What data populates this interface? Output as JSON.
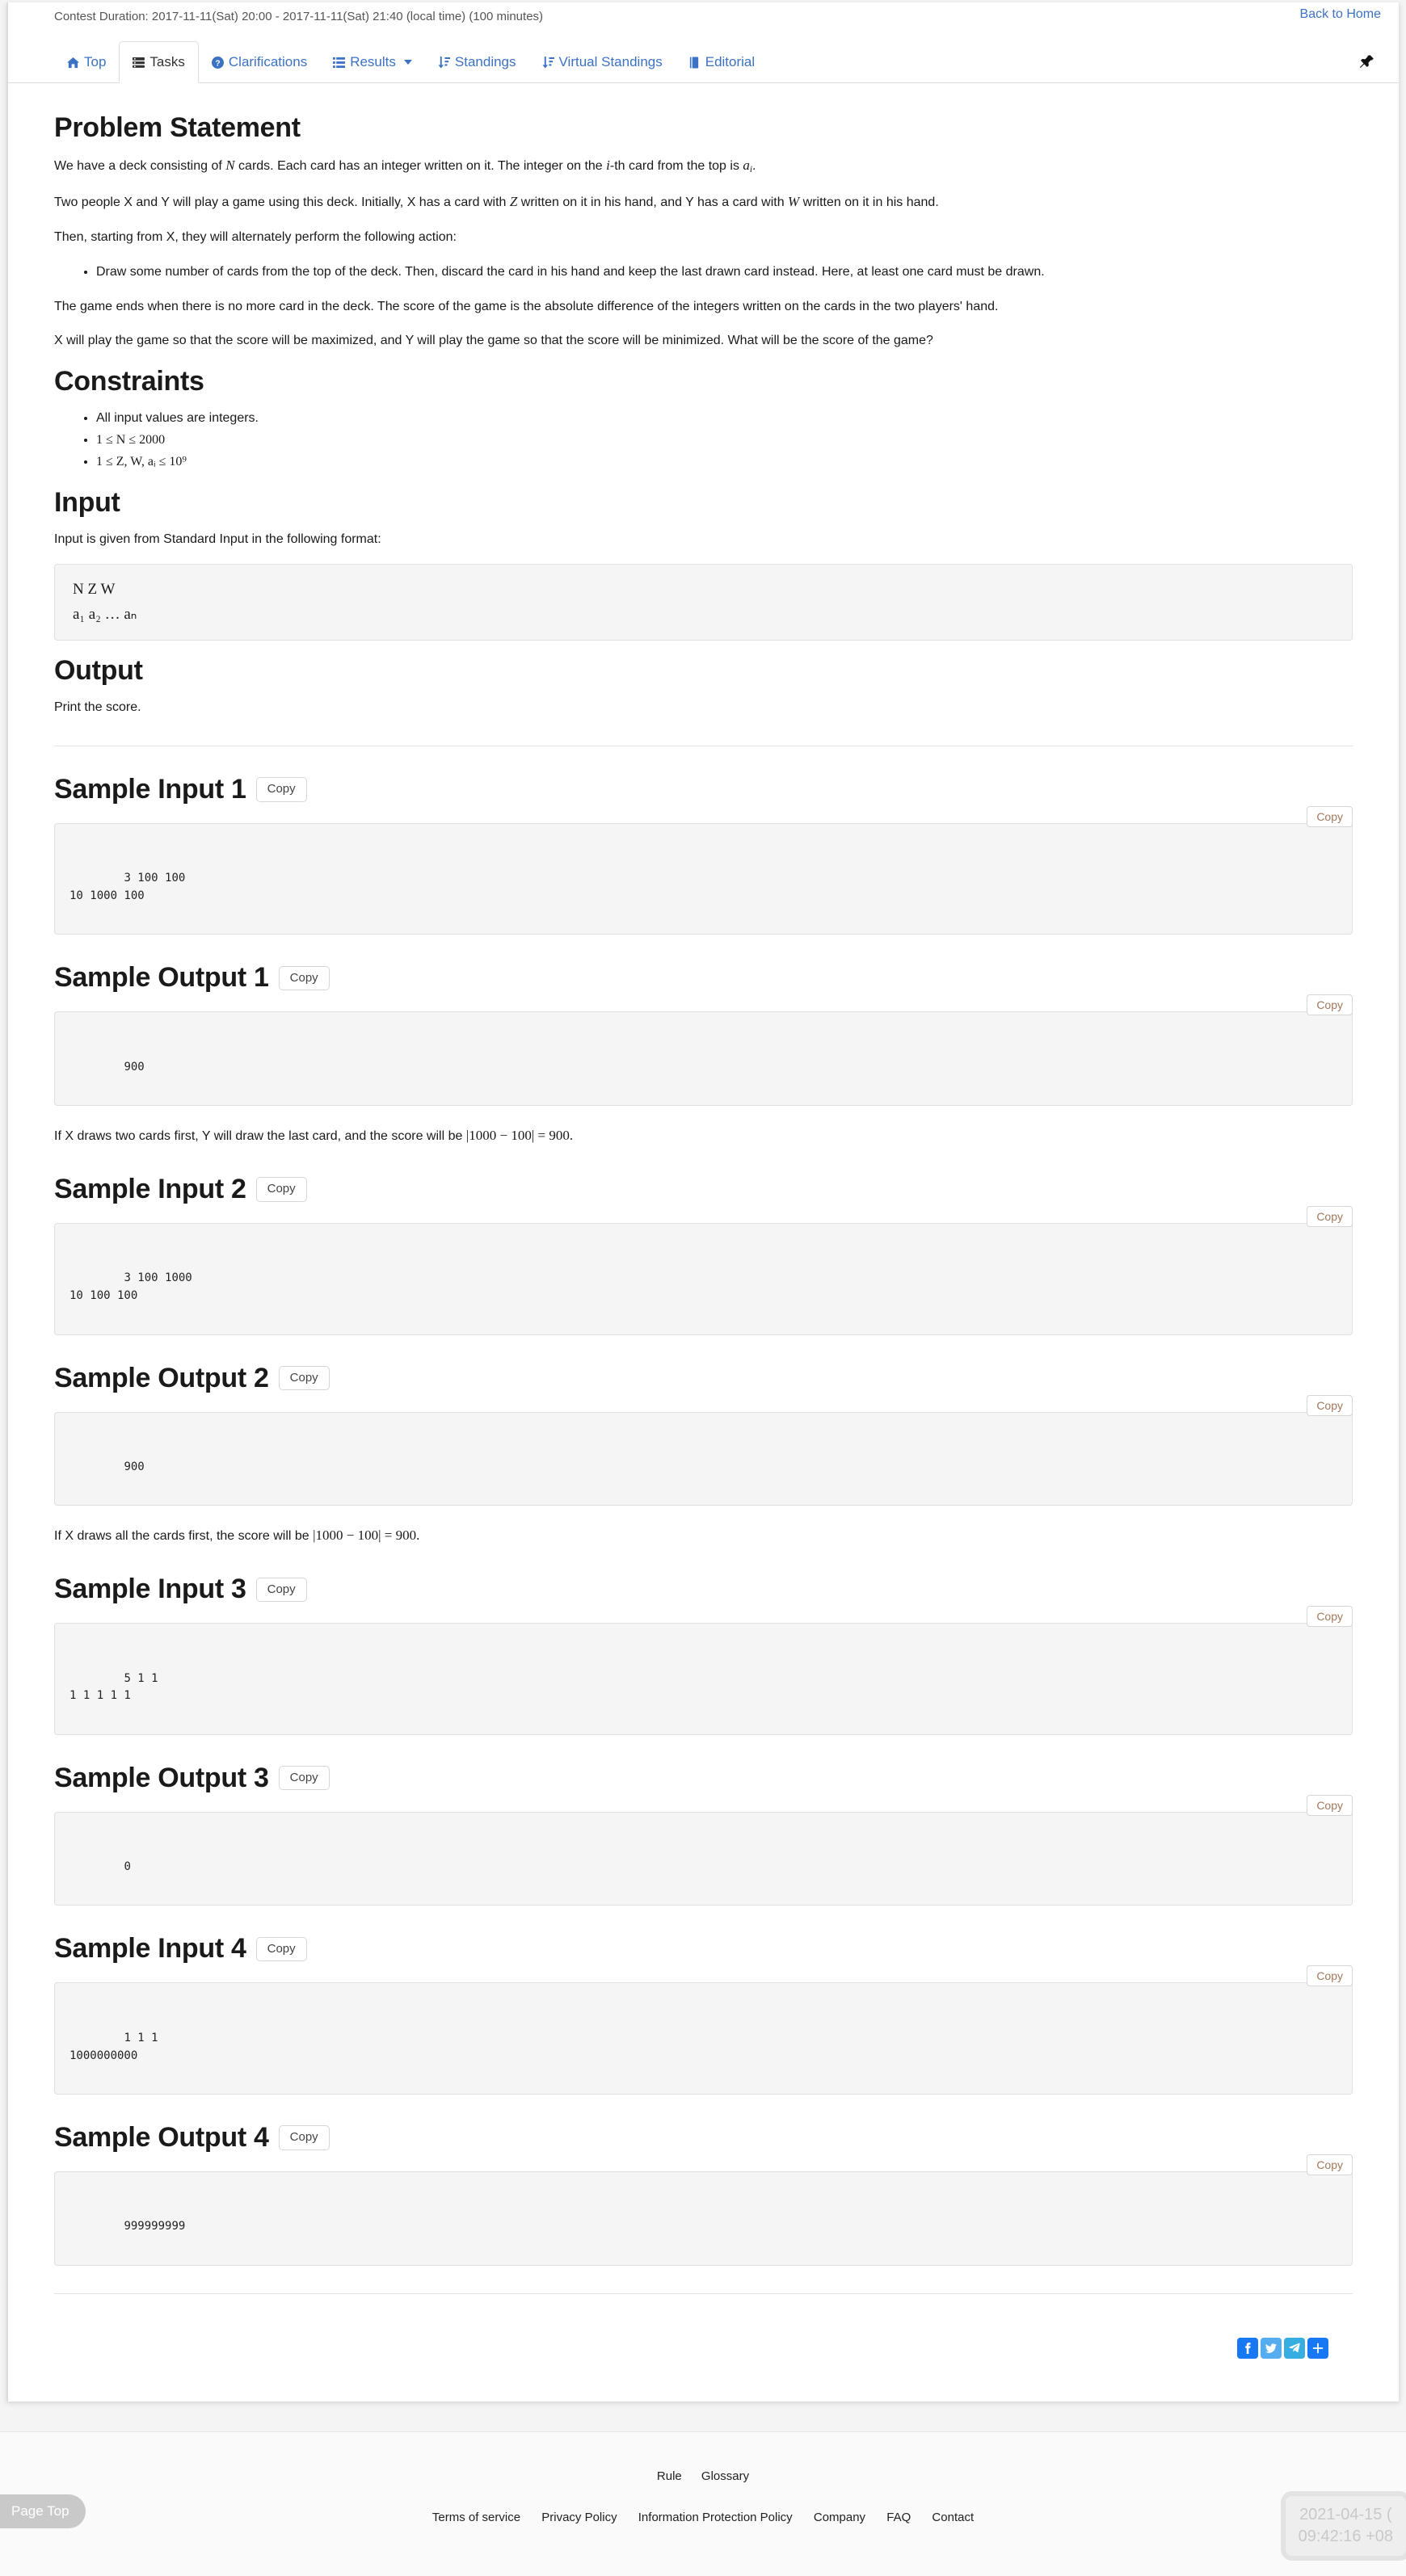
{
  "header": {
    "contest_duration": "Contest Duration: 2017-11-11(Sat) 20:00 - 2017-11-11(Sat) 21:40 (local time) (100 minutes)",
    "back_to_home": "Back to Home",
    "pin_icon": "pin-icon"
  },
  "nav": {
    "tabs": [
      {
        "label": "Top",
        "icon": "home-icon",
        "active": false
      },
      {
        "label": "Tasks",
        "icon": "tasks-icon",
        "active": true
      },
      {
        "label": "Clarifications",
        "icon": "question-circle-icon",
        "active": false
      },
      {
        "label": "Results",
        "icon": "list-icon",
        "active": false,
        "caret": true
      },
      {
        "label": "Standings",
        "icon": "sort-amount-icon",
        "active": false
      },
      {
        "label": "Virtual Standings",
        "icon": "sort-amount-icon",
        "active": false
      },
      {
        "label": "Editorial",
        "icon": "book-icon",
        "active": false
      }
    ]
  },
  "sections": {
    "problem_statement": {
      "title": "Problem Statement",
      "p1_a": "We have a deck consisting of ",
      "p1_N": "N",
      "p1_b": " cards. Each card has an integer written on it. The integer on the ",
      "p1_i": "i",
      "p1_c": "-th card from the top is ",
      "p1_ai": "a",
      "p1_ai_sub": "i",
      "p1_d": ".",
      "p2_a": "Two people X and Y will play a game using this deck. Initially, X has a card with ",
      "p2_Z": "Z",
      "p2_b": " written on it in his hand, and Y has a card with ",
      "p2_W": "W",
      "p2_c": " written on it in his hand.",
      "p3": "Then, starting from X, they will alternately perform the following action:",
      "bullet1": "Draw some number of cards from the top of the deck. Then, discard the card in his hand and keep the last drawn card instead. Here, at least one card must be drawn.",
      "p4": "The game ends when there is no more card in the deck. The score of the game is the absolute difference of the integers written on the cards in the two players' hand.",
      "p5": "X will play the game so that the score will be maximized, and Y will play the game so that the score will be minimized. What will be the score of the game?"
    },
    "constraints": {
      "title": "Constraints",
      "items": [
        {
          "kind": "text",
          "text": "All input values are integers."
        },
        {
          "kind": "math",
          "text": "1 ≤ N ≤ 2000"
        },
        {
          "kind": "math",
          "text": "1 ≤ Z, W, aᵢ ≤ 10⁹"
        }
      ]
    },
    "input": {
      "title": "Input",
      "lead": "Input is given from Standard Input in the following format:",
      "format_line1": "N  Z  W",
      "format_line2": "a₁  a₂  …  aₙ"
    },
    "output": {
      "title": "Output",
      "lead": "Print the score."
    }
  },
  "samples": [
    {
      "title": "Sample Input 1",
      "copy_label": "Copy",
      "inner_copy_label": "Copy",
      "code": "3 100 100\n10 1000 100",
      "explanation": "If X draws two cards first, Y will draw the last card, and the score will be |1000 − 100| = 900."
    },
    {
      "title": "Sample Output 1",
      "copy_label": "Copy",
      "inner_copy_label": "Copy",
      "code": "900",
      "explanation": ""
    },
    {
      "title": "Sample Input 2",
      "copy_label": "Copy",
      "inner_copy_label": "Copy",
      "code": "3 100 1000\n10 100 100",
      "explanation": ""
    },
    {
      "title": "Sample Output 2",
      "copy_label": "Copy",
      "inner_copy_label": "Copy",
      "code": "900",
      "explanation": "If X draws all the cards first, the score will be |1000 − 100| = 900."
    },
    {
      "title": "Sample Input 3",
      "copy_label": "Copy",
      "inner_copy_label": "Copy",
      "code": "5 1 1\n1 1 1 1 1",
      "explanation": ""
    },
    {
      "title": "Sample Output 3",
      "copy_label": "Copy",
      "inner_copy_label": "Copy",
      "code": "0",
      "explanation": ""
    },
    {
      "title": "Sample Input 4",
      "copy_label": "Copy",
      "inner_copy_label": "Copy",
      "code": "1 1 1\n1000000000",
      "explanation": ""
    },
    {
      "title": "Sample Output 4",
      "copy_label": "Copy",
      "inner_copy_label": "Copy",
      "code": "999999999",
      "explanation": ""
    }
  ],
  "explanations": {
    "sample1_a": "If X draws two cards first, Y will draw the last card, and the score will be ",
    "sample1_math": "|1000 − 100| = 900.",
    "sample2_a": "If X draws all the cards first, the score will be ",
    "sample2_math": "|1000 − 100| = 900."
  },
  "social": [
    {
      "name": "facebook-share-button",
      "glyph": "f"
    },
    {
      "name": "twitter-share-button",
      "glyph": "🐦"
    },
    {
      "name": "telegram-share-button",
      "glyph": "➤"
    },
    {
      "name": "more-share-button",
      "glyph": "+"
    }
  ],
  "footer": {
    "top_links": [
      "Rule",
      "Glossary"
    ],
    "bottom_links": [
      "Terms of service",
      "Privacy Policy",
      "Information Protection Policy",
      "Company",
      "FAQ",
      "Contact"
    ]
  },
  "widgets": {
    "page_top": "Page Top",
    "clock_line1": "2021-04-15 (",
    "clock_line2": "09:42:16 +08"
  }
}
